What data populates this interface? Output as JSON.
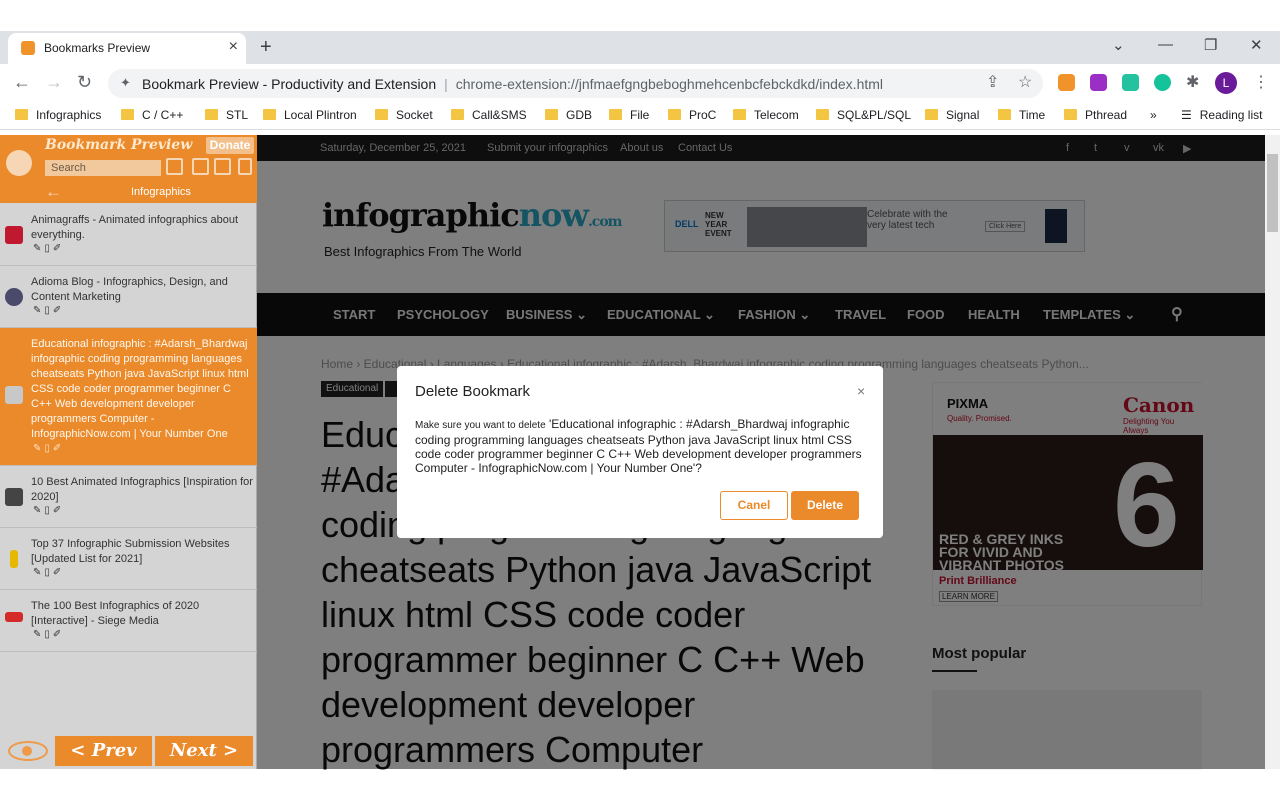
{
  "browser": {
    "tab_title": "Bookmarks Preview",
    "omnibox_title": "Bookmark Preview - Productivity and Extension",
    "omnibox_url": "chrome-extension://jnfmaefgngbeboghmehcenbcfebckdkd/index.html",
    "profile_initial": "L",
    "bookmarks": [
      "Infographics",
      "C / C++",
      "STL",
      "Local Plintron",
      "Socket",
      "Call&SMS",
      "GDB",
      "File",
      "ProC",
      "Telecom",
      "SQL&PL/SQL",
      "Signal",
      "Time",
      "Pthread"
    ],
    "overflow": "»",
    "reading_list": "Reading list"
  },
  "extension": {
    "title": "Bookmark Preview",
    "donate": "Donate",
    "search_placeholder": "Search",
    "folder": "Infographics",
    "prev": "< Prev",
    "next": "Next >",
    "items": [
      {
        "title": "Animagraffs - Animated infographics about everything.",
        "icon_color": "#c0182e"
      },
      {
        "title": "Adioma Blog - Infographics, Design, and Content Marketing",
        "icon_color": "#4a4a6a"
      },
      {
        "title": "Educational infographic : #Adarsh_Bhardwaj infographic coding programming languages cheatseats Python java JavaScript linux html CSS code coder programmer beginner C C++ Web development developer programmers Computer - InfographicNow.com | Your Number One",
        "icon_color": "#c8c8c8"
      },
      {
        "title": "10 Best Animated Infographics [Inspiration for 2020]",
        "icon_color": "#444444"
      },
      {
        "title": "Top 37 Infographic Submission Websites [Updated List for 2021]",
        "icon_color": "#e6b800"
      },
      {
        "title": "The 100 Best Infographics of 2020 [Interactive] - Siege Media",
        "icon_color": "#d42a2a"
      }
    ]
  },
  "website": {
    "date": "Saturday, December 25, 2021",
    "top_links": [
      "Submit your infographics",
      "About us",
      "Contact Us"
    ],
    "logo_main": "infographic",
    "logo_now": "now",
    "logo_com": ".com",
    "tagline": "Best Infographics From The World",
    "menu": [
      "START",
      "PSYCHOLOGY",
      "BUSINESS",
      "EDUCATIONAL",
      "FASHION",
      "TRAVEL",
      "FOOD",
      "HEALTH",
      "TEMPLATES"
    ],
    "breadcrumb": "Home  ›  Educational  ›  Languages  ›  Educational infographic : #Adarsh_Bhardwaj infographic coding programming languages cheatseats Python...",
    "tag": "Educational",
    "headline": "Educational infographic : #Adarsh_Bhardwaj infographic coding programming languages cheatseats Python java JavaScript linux html CSS code coder programmer beginner C C++ Web development developer programmers Computer",
    "ad_top": {
      "brand": "DELL",
      "event": "NEW YEAR EVENT",
      "headline": "Celebrate with the very latest tech",
      "cta": "Click Here"
    },
    "ad_side": {
      "product": "PIXMA",
      "promise": "Quality. Promised.",
      "brand": "Canon",
      "delight": "Delighting You Always",
      "caption": "RED & GREY INKS FOR VIVID AND VIBRANT PHOTOS",
      "print": "Print Brilliance",
      "learn": "LEARN MORE",
      "number": "6"
    },
    "most_popular": "Most popular"
  },
  "dialog": {
    "title": "Delete Bookmark",
    "close": "×",
    "prefix": "Make sure you want to delete",
    "message": "'Educational infographic : #Adarsh_Bhardwaj infographic coding programming languages cheatseats Python java JavaScript linux html CSS code coder programmer beginner C C++ Web development developer programmers Computer - InfographicNow.com | Your Number One'?",
    "cancel": "Canel",
    "delete": "Delete"
  },
  "colors": {
    "accent": "#eb8a2b",
    "dark": "#111111"
  }
}
